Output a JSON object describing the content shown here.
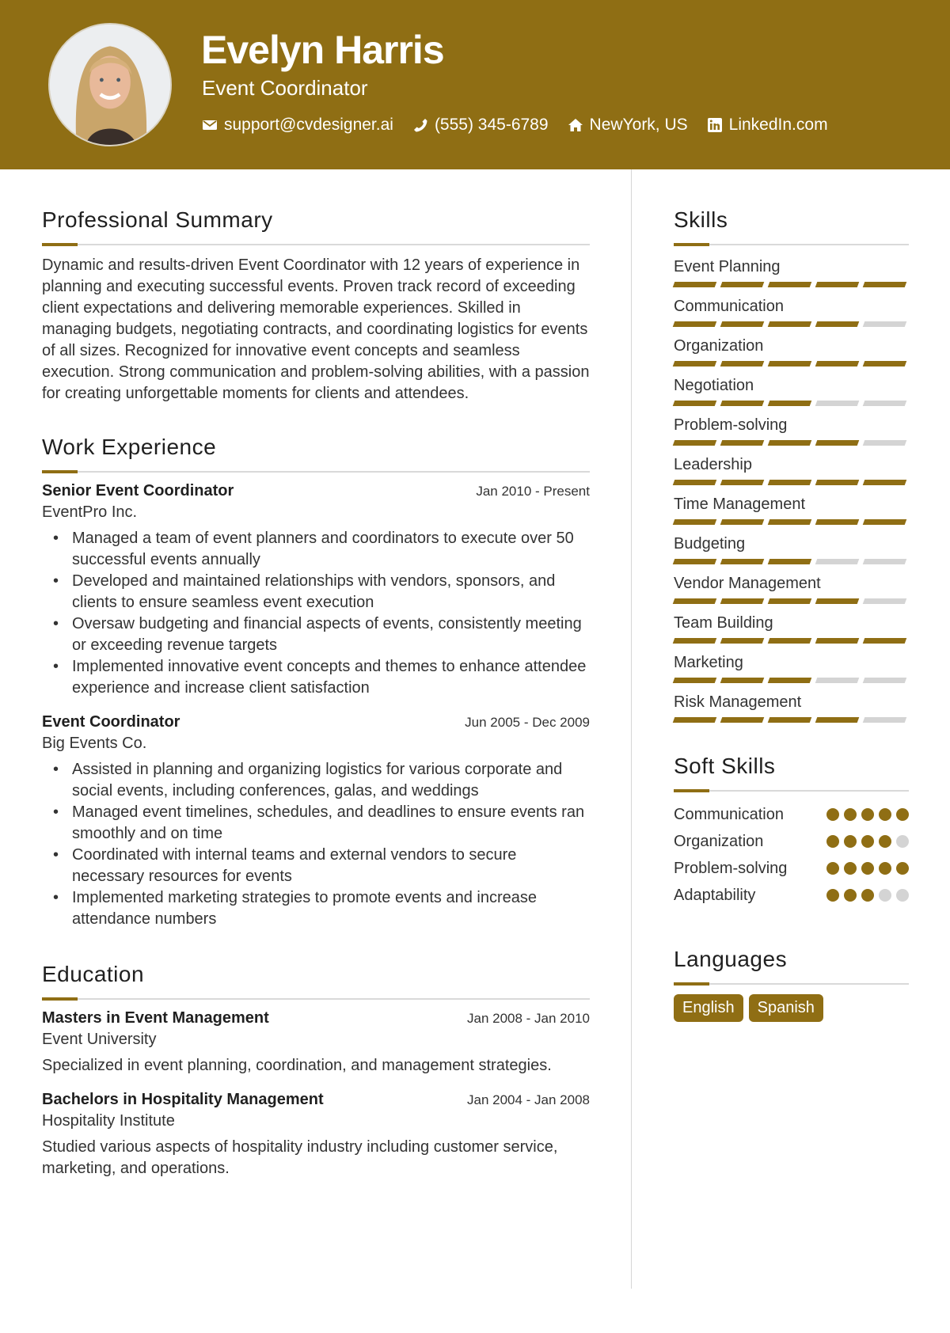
{
  "header": {
    "name": "Evelyn Harris",
    "role": "Event Coordinator",
    "contacts": [
      {
        "icon": "envelope-icon",
        "label": "support@cvdesigner.ai"
      },
      {
        "icon": "phone-icon",
        "label": "(555) 345-6789"
      },
      {
        "icon": "home-icon",
        "label": "NewYork, US"
      },
      {
        "icon": "linkedin-icon",
        "label": "LinkedIn.com"
      }
    ]
  },
  "colors": {
    "accent": "#8f6e14",
    "inactive": "#d4d4d4",
    "rule": "#d9d9d9"
  },
  "summary": {
    "title": "Professional Summary",
    "text": "Dynamic and results-driven Event Coordinator with 12 years of experience in planning and executing successful events. Proven track record of exceeding client expectations and delivering memorable experiences. Skilled in managing budgets, negotiating contracts, and coordinating logistics for events of all sizes. Recognized for innovative event concepts and seamless execution. Strong communication and problem-solving abilities, with a passion for creating unforgettable moments for clients and attendees."
  },
  "experience": {
    "title": "Work Experience",
    "jobs": [
      {
        "title": "Senior Event Coordinator",
        "date": "Jan 2010 - Present",
        "org": "EventPro Inc.",
        "bullets": [
          "Managed a team of event planners and coordinators to execute over 50 successful events annually",
          "Developed and maintained relationships with vendors, sponsors, and clients to ensure seamless event execution",
          "Oversaw budgeting and financial aspects of events, consistently meeting or exceeding revenue targets",
          "Implemented innovative event concepts and themes to enhance attendee experience and increase client satisfaction"
        ]
      },
      {
        "title": "Event Coordinator",
        "date": "Jun 2005 - Dec 2009",
        "org": "Big Events Co.",
        "bullets": [
          "Assisted in planning and organizing logistics for various corporate and social events, including conferences, galas, and weddings",
          "Managed event timelines, schedules, and deadlines to ensure events ran smoothly and on time",
          "Coordinated with internal teams and external vendors to secure necessary resources for events",
          "Implemented marketing strategies to promote events and increase attendance numbers"
        ]
      }
    ]
  },
  "education": {
    "title": "Education",
    "items": [
      {
        "degree": "Masters in Event Management",
        "date": "Jan 2008 - Jan 2010",
        "school": "Event University",
        "desc": "Specialized in event planning, coordination, and management strategies."
      },
      {
        "degree": "Bachelors in Hospitality Management",
        "date": "Jan 2004 - Jan 2008",
        "school": "Hospitality Institute",
        "desc": "Studied various aspects of hospitality industry including customer service, marketing, and operations."
      }
    ]
  },
  "skills": {
    "title": "Skills",
    "max": 5,
    "items": [
      {
        "label": "Event Planning",
        "level": 5
      },
      {
        "label": "Communication",
        "level": 4
      },
      {
        "label": "Organization",
        "level": 5
      },
      {
        "label": "Negotiation",
        "level": 3
      },
      {
        "label": "Problem-solving",
        "level": 4
      },
      {
        "label": "Leadership",
        "level": 5
      },
      {
        "label": "Time Management",
        "level": 5
      },
      {
        "label": "Budgeting",
        "level": 3
      },
      {
        "label": "Vendor Management",
        "level": 4
      },
      {
        "label": "Team Building",
        "level": 5
      },
      {
        "label": "Marketing",
        "level": 3
      },
      {
        "label": "Risk Management",
        "level": 4
      }
    ]
  },
  "soft_skills": {
    "title": "Soft Skills",
    "max": 5,
    "items": [
      {
        "label": "Communication",
        "level": 5
      },
      {
        "label": "Organization",
        "level": 4
      },
      {
        "label": "Problem-solving",
        "level": 5
      },
      {
        "label": "Adaptability",
        "level": 3
      }
    ]
  },
  "languages": {
    "title": "Languages",
    "items": [
      "English",
      "Spanish"
    ]
  }
}
